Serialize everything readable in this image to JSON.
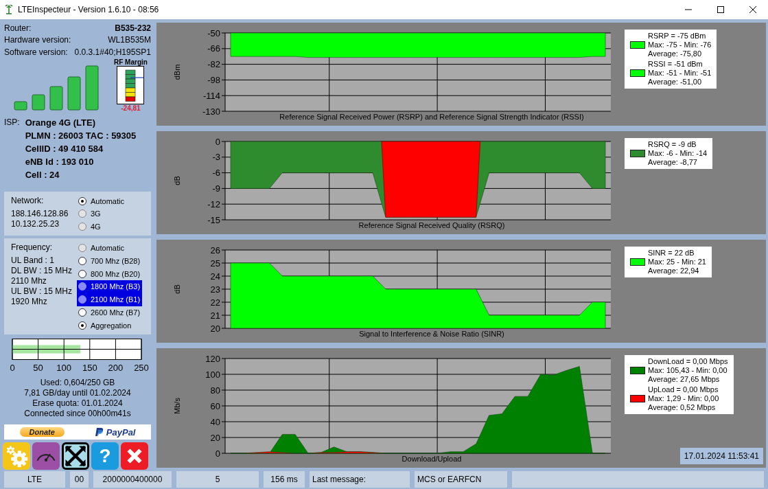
{
  "window": {
    "title": "LTEInspecteur - Version 1.6.10 - 08:56"
  },
  "router": [
    {
      "label": "Router:",
      "value": "B535-232"
    },
    {
      "label": "Hardware version:",
      "value": "WL1B535M"
    },
    {
      "label": "Software version:",
      "value": "0.0.3.1#40;H195SP1"
    }
  ],
  "rf_margin": {
    "label": "RF Margin",
    "value": "-24,81"
  },
  "isp": {
    "label": "ISP:",
    "lines": [
      "Orange 4G (LTE)",
      "PLMN : 26003 TAC : 59305",
      "CellID : 49 410 584",
      "eNB Id : 193 010",
      "Cell : 24"
    ]
  },
  "network": {
    "label": "Network:",
    "info": [
      "188.146.128.86",
      "10.132.25.23"
    ],
    "options": [
      {
        "label": "Automatic",
        "selected": true,
        "disabled": false,
        "highlighted": false
      },
      {
        "label": "3G",
        "selected": false,
        "disabled": true,
        "highlighted": false
      },
      {
        "label": "4G",
        "selected": false,
        "disabled": true,
        "highlighted": false
      }
    ]
  },
  "frequency": {
    "label": "Frequency:",
    "info": [
      "UL Band : 1",
      "DL BW : 15 MHz",
      "2110 Mhz",
      "UL BW : 15 MHz",
      "1920 Mhz"
    ],
    "options": [
      {
        "label": "Automatic",
        "selected": false,
        "disabled": true,
        "highlighted": false
      },
      {
        "label": "700 Mhz (B28)",
        "selected": false,
        "disabled": false,
        "highlighted": false
      },
      {
        "label": "800 Mhz (B20)",
        "selected": false,
        "disabled": false,
        "highlighted": false
      },
      {
        "label": "1800 Mhz (B3)",
        "selected": false,
        "disabled": false,
        "highlighted": true
      },
      {
        "label": "2100 Mhz (B1)",
        "selected": false,
        "disabled": false,
        "highlighted": true
      },
      {
        "label": "2600 Mhz (B7)",
        "selected": false,
        "disabled": false,
        "highlighted": false
      },
      {
        "label": "Aggregation",
        "selected": true,
        "disabled": false,
        "highlighted": false
      }
    ]
  },
  "quota": {
    "level": 0.528,
    "scale": [
      "0",
      "50",
      "100",
      "150",
      "200",
      "250"
    ]
  },
  "usage": [
    "Used: 0,604/250 GB",
    "7,81 GB/day until 01.02.2024",
    "Erase quota: 01.01.2024",
    "Connected since 00h00m41s"
  ],
  "donate": {
    "label": "Donate",
    "brand": "PayPal"
  },
  "tools": [
    {
      "kind": "settings"
    },
    {
      "kind": "speed"
    },
    {
      "kind": "fullscreen"
    },
    {
      "kind": "help",
      "label": "?"
    },
    {
      "kind": "close"
    }
  ],
  "charts": [
    {
      "chart_data": {
        "type": "area",
        "title": "Reference Signal Received Power (RSRP) and Reference Signal Strength Indicator (RSSI)",
        "ylabel": "dBm",
        "ylim": [
          -130,
          -50
        ],
        "yticks": [
          -50,
          -66,
          -82,
          -98,
          -114,
          -130
        ],
        "grid": true,
        "series": [
          {
            "color": "#00ff00",
            "values": [
              -74,
              -74,
              -74,
              -74,
              -74,
              -74,
              -75,
              -75,
              -75,
              -75,
              -75,
              -75,
              -75,
              -75,
              -75,
              -75,
              -75,
              -75,
              -75,
              -75,
              -75,
              -75,
              -75,
              -75,
              -75,
              -75,
              -75,
              -75,
              -74,
              -74
            ]
          }
        ]
      },
      "legend": [
        {
          "color": "#00ff00",
          "lines": [
            "RSRP = -75 dBm",
            "Max: -75 - Min: -76",
            "Average: -75,80"
          ]
        },
        {
          "color": "#00ff00",
          "lines": [
            "RSSI = -51 dBm",
            "Max: -51 - Min: -51",
            "Average: -51,00"
          ]
        }
      ]
    },
    {
      "chart_data": {
        "type": "area",
        "title": "Reference Signal Received Quality (RSRQ)",
        "ylabel": "dB",
        "ylim": [
          -15,
          0
        ],
        "yticks": [
          0,
          -3,
          -6,
          -9,
          -12,
          -15
        ],
        "grid": true,
        "series": [
          {
            "color": "#2e8b2e",
            "values": [
              -9,
              -9,
              -9,
              -9,
              -6,
              -6,
              -6,
              -6,
              -6,
              -6,
              -6,
              -6,
              -14.5,
              -14.5,
              -14.5,
              -14.5,
              -14.5,
              -14.5,
              -14.5,
              -14.5,
              -6,
              -6,
              -6,
              -6,
              -6,
              -6,
              -6,
              -6,
              -9,
              -9
            ]
          }
        ]
      },
      "legend": [
        {
          "color": "#2e8b2e",
          "lines": [
            "RSRQ = -9 dB",
            "Max: -6 - Min: -14",
            "Average: -8,77"
          ]
        }
      ]
    },
    {
      "chart_data": {
        "type": "area",
        "title": "Signal to Interference & Noise Ratio (SINR)",
        "ylabel": "dB",
        "ylim": [
          20,
          26
        ],
        "yticks": [
          26,
          25,
          24,
          23,
          22,
          21,
          20
        ],
        "grid": true,
        "series": [
          {
            "color": "#00ff00",
            "values": [
              25,
              25,
              25,
              25,
              24,
              24,
              24,
              24,
              24,
              24,
              24,
              24,
              23,
              23,
              23,
              23,
              23,
              23,
              23,
              23,
              21,
              21,
              21,
              21,
              21,
              21,
              21,
              21,
              22,
              22
            ]
          }
        ]
      },
      "legend": [
        {
          "color": "#00ff00",
          "lines": [
            "SINR = 22 dB",
            "Max: 25 - Min: 21",
            "Average: 22,94"
          ]
        }
      ]
    },
    {
      "chart_data": {
        "type": "area",
        "title": "Download/Upload",
        "ylabel": "Mb/s",
        "ylim": [
          0,
          120
        ],
        "yticks": [
          120,
          100,
          80,
          60,
          40,
          20,
          0
        ],
        "grid": true,
        "series": [
          {
            "color": "#008000",
            "values": [
              0,
              0,
              0,
              0,
              24,
              24,
              0,
              1,
              8,
              2,
              2,
              1,
              0,
              0,
              0,
              0,
              0,
              2,
              2,
              12,
              48,
              50,
              72,
              72,
              100,
              99,
              105,
              110,
              0,
              0
            ]
          },
          {
            "color": "#ff0000",
            "values": [
              0,
              0,
              1,
              2,
              1,
              0,
              0,
              1,
              1,
              2,
              2,
              1,
              0,
              0,
              0,
              0,
              0,
              0,
              0,
              0,
              0,
              0,
              0,
              0,
              0,
              0,
              0,
              0,
              0,
              0
            ]
          }
        ]
      },
      "legend": [
        {
          "color": "#008000",
          "lines": [
            "DownLoad = 0,00 Mbps",
            "Max: 105,43 - Min: 0,00",
            "Average: 27,65 Mbps"
          ]
        },
        {
          "color": "#ff0000",
          "lines": [
            "UpLoad = 0,00 Mbps",
            "Max: 1,29 - Min: 0,00",
            "Average: 0,52 Mbps"
          ]
        }
      ],
      "timestamp": "17.01.2024 11:53:41"
    }
  ],
  "status_bar": [
    "LTE",
    "00",
    "2000000400000",
    "5",
    "156 ms",
    "Last message:",
    "MCS or EARFCN"
  ]
}
